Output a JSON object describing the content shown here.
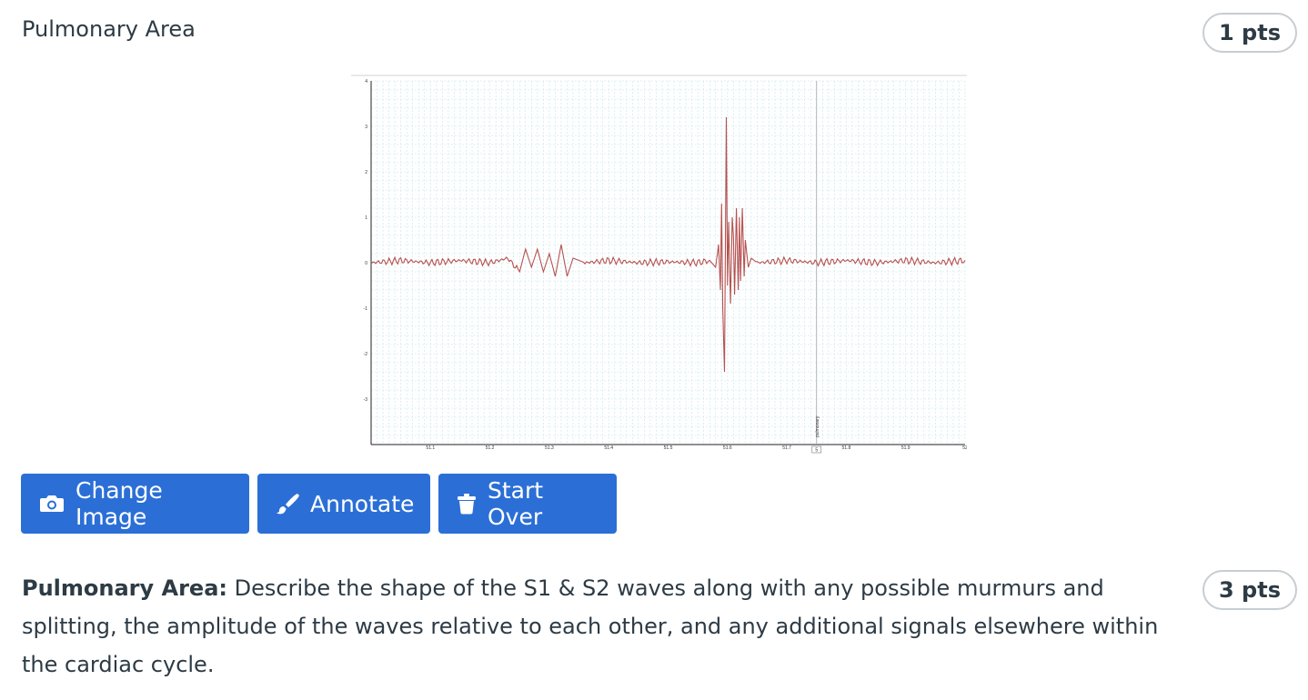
{
  "question1": {
    "title": "Pulmonary Area",
    "points": "1 pts"
  },
  "chart_data": {
    "type": "line",
    "title": "",
    "xlabel": "",
    "ylabel": "",
    "ylim": [
      -4,
      4
    ],
    "xlim": [
      51.0,
      52.0
    ],
    "grid": true,
    "y_ticks": [
      "4",
      "3",
      "2",
      "1",
      "0",
      "-1",
      "-2",
      "-3"
    ],
    "x_ticks": [
      "51.1",
      "51.2",
      "51.3",
      "51.4",
      "51.5",
      "51.6",
      "51.7",
      "51.8",
      "51.9",
      "52"
    ],
    "marker_label": "pulmonary",
    "marker_tag": "5",
    "series_color": "#b5514f",
    "series": [
      {
        "x": [
          51.0,
          51.05,
          51.1,
          51.15,
          51.2,
          51.23,
          51.25,
          51.26,
          51.27,
          51.28,
          51.29,
          51.3,
          51.31,
          51.32,
          51.33,
          51.34,
          51.36,
          51.4,
          51.45,
          51.5,
          51.55,
          51.57,
          51.58,
          51.585,
          51.588,
          51.59,
          51.592,
          51.595,
          51.598,
          51.6,
          51.602,
          51.605,
          51.608,
          51.61,
          51.612,
          51.615,
          51.618,
          51.62,
          51.622,
          51.625,
          51.628,
          51.63,
          51.635,
          51.64,
          51.65,
          51.7,
          51.75,
          51.8,
          51.85,
          51.9,
          51.95,
          52.0
        ],
        "values": [
          0,
          0.05,
          0,
          0.05,
          0,
          0.1,
          -0.2,
          0.3,
          -0.1,
          0.3,
          -0.2,
          0.2,
          -0.3,
          0.4,
          -0.3,
          0.1,
          0,
          0.05,
          0,
          0.02,
          0,
          0.05,
          -0.1,
          0.4,
          -0.6,
          1.3,
          -1.0,
          -2.4,
          3.2,
          -0.5,
          0.9,
          -0.9,
          1.0,
          0.6,
          -0.7,
          1.2,
          -0.6,
          1.0,
          -0.4,
          1.2,
          -0.3,
          0.5,
          -0.1,
          0.1,
          0,
          0.05,
          0,
          0.05,
          0,
          0.05,
          0,
          0.05
        ]
      }
    ]
  },
  "buttons": {
    "change_image": "Change Image",
    "annotate": "Annotate",
    "start_over": "Start Over"
  },
  "question2": {
    "label": "Pulmonary Area:",
    "text": " Describe the shape of the S1 & S2 waves along with any possible murmurs and splitting, the amplitude of the waves relative to each other, and any additional signals elsewhere within the cardiac cycle.",
    "points": "3 pts"
  },
  "colors": {
    "button_bg": "#2b6fd6",
    "grid": "#bfe6ee",
    "trace": "#b5514f"
  },
  "icons": {
    "change_image": "camera-icon",
    "annotate": "brush-icon",
    "start_over": "trash-icon"
  }
}
